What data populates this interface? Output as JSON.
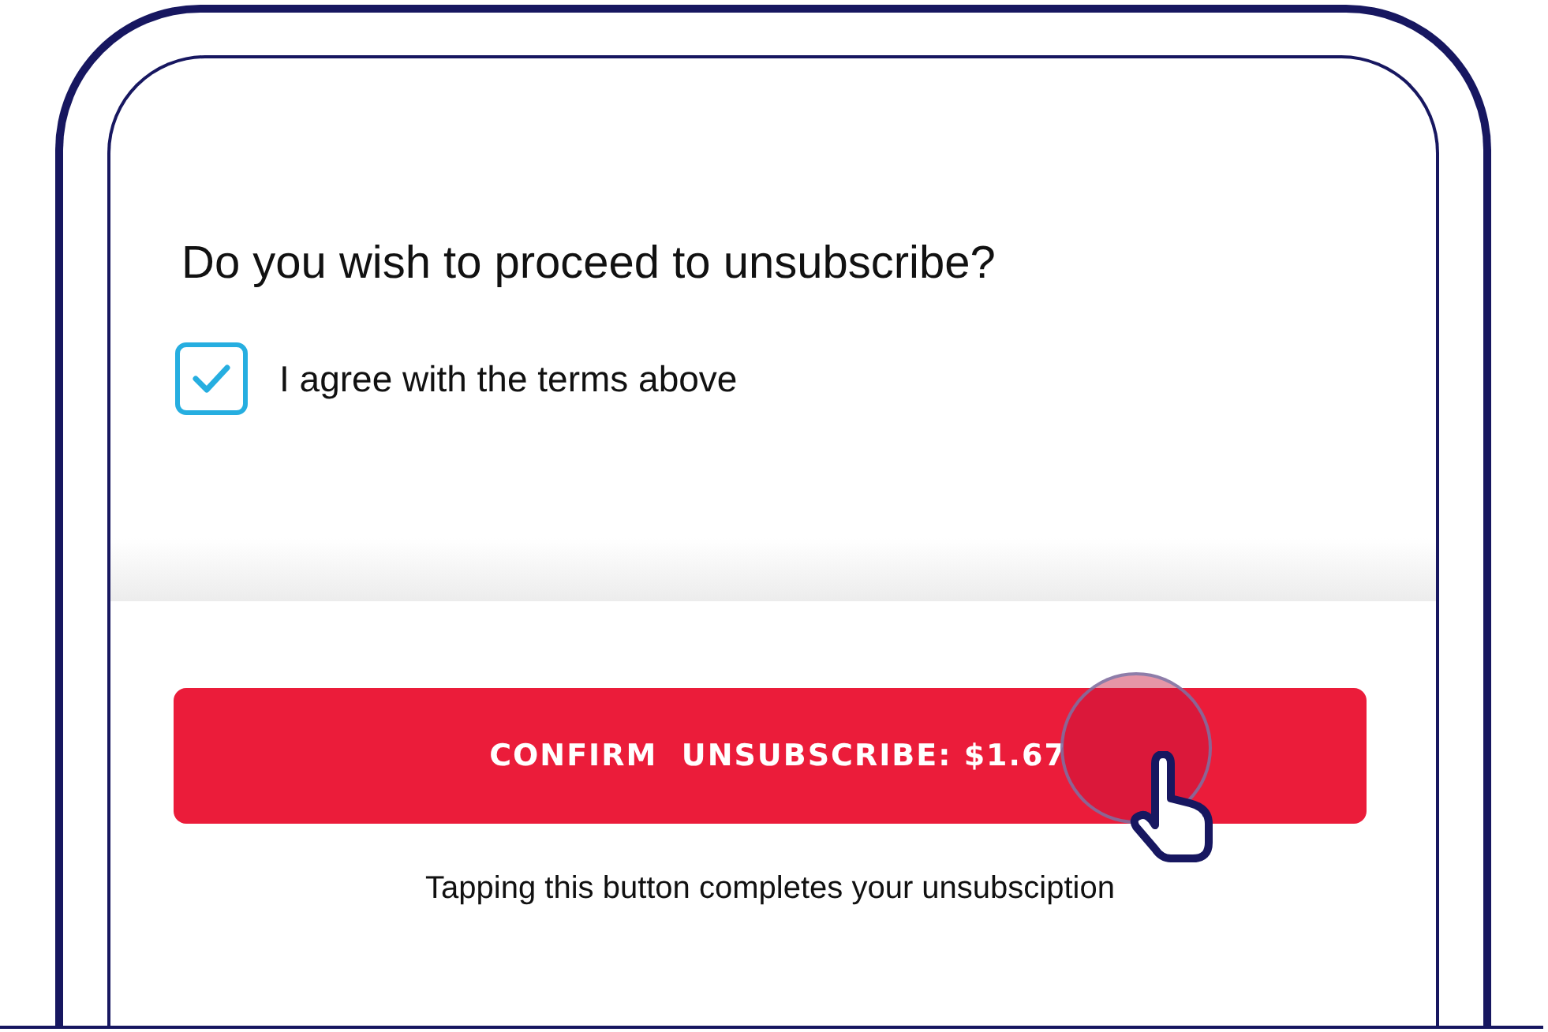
{
  "question": "Do you wish to proceed to unsubscribe?",
  "agreement": {
    "label": "I agree with the terms above",
    "checked": true
  },
  "confirm_button": {
    "label": "CONFIRM  UNSUBSCRIBE: $1.67"
  },
  "caption": "Tapping this button completes your unsubsciption"
}
